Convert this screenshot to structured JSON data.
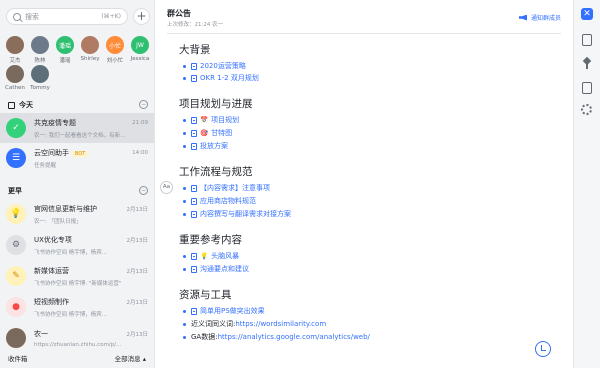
{
  "sidebar": {
    "search_placeholder": "搜索",
    "search_shortcut": "(⌘+K)",
    "add_label": "+",
    "avatars": [
      {
        "name": "艾杰",
        "initial": "",
        "color": "#8a6d5a"
      },
      {
        "name": "陈林",
        "initial": "",
        "color": "#6d7a8a"
      },
      {
        "name": "潘瑶",
        "initial": "潘瑶",
        "color": "#2fbf71"
      },
      {
        "name": "Shirley",
        "initial": "",
        "color": "#b07b62"
      },
      {
        "name": "刘小忙",
        "initial": "小忙",
        "color": "#ff8c3a"
      },
      {
        "name": "Jessica",
        "initial": "JW",
        "color": "#2fbf71"
      },
      {
        "name": "Cathen",
        "initial": "",
        "color": "#7a6a5e"
      },
      {
        "name": "Tommy",
        "initial": "",
        "color": "#5e6f7a"
      }
    ],
    "section_today": "今天",
    "section_earlier": "更早",
    "toggle": "−",
    "chats": [
      {
        "name": "共克疫情专题",
        "time": "21:09",
        "preview": "农一: 我们一起看看这个文档，有新...",
        "color": "#33d17a",
        "glyph": "✓",
        "selected": true
      },
      {
        "name": "云空间助手",
        "badge": "BOT",
        "time": "14:00",
        "preview": "任务提醒",
        "color": "#3370ff",
        "glyph": "☰"
      },
      {
        "name": "官网信息更新与维护",
        "time": "2月13日",
        "preview": "农一: 「团队日报」",
        "color": "#ffc60a",
        "glyph": "💡"
      },
      {
        "name": "UX优化专项",
        "time": "2月13日",
        "preview": "飞书协作空间 杨宇博，杨宾...",
        "color": "#8f959e",
        "glyph": "⚙"
      },
      {
        "name": "新媒体运营",
        "time": "2月13日",
        "preview": "飞书协作空间 杨宇博: \"新媒体运营\"",
        "color": "#ffc60a",
        "glyph": "✎"
      },
      {
        "name": "短视频制作",
        "time": "2月13日",
        "preview": "飞书协作空间 杨宇博，杨宾...",
        "color": "#f54a45",
        "glyph": "●"
      },
      {
        "name": "农一",
        "time": "2月13日",
        "preview": "https://zhuanlan.zhihu.com/p/...",
        "color": "#7a6a5e",
        "glyph": ""
      }
    ],
    "footer_left": "收件箱",
    "footer_right": "全部消息 ▴"
  },
  "doc": {
    "title": "群公告",
    "edited": "上次修改：21:24 农一",
    "notify": "通知群成员",
    "aa": "Aa",
    "sections": [
      {
        "heading": "大背景",
        "items": [
          {
            "text": "2020运营策略",
            "emoji": ""
          },
          {
            "text": "OKR 1-2 双月规划",
            "emoji": ""
          }
        ]
      },
      {
        "heading": "项目规划与进展",
        "items": [
          {
            "text": "项目规划",
            "emoji": "📅"
          },
          {
            "text": "甘特图",
            "emoji": "🎯"
          },
          {
            "text": "投放方案",
            "emoji": ""
          }
        ]
      },
      {
        "heading": "工作流程与规范",
        "items": [
          {
            "text": "【内容需求】注意事项",
            "emoji": ""
          },
          {
            "text": "应用商店物料规范",
            "emoji": ""
          },
          {
            "text": "内容撰写与翻译需求对接方案",
            "emoji": ""
          }
        ]
      },
      {
        "heading": "重要参考内容",
        "items": [
          {
            "text": "头脑风暴",
            "emoji": "💡"
          },
          {
            "text": "沟通要点和建议",
            "emoji": ""
          }
        ]
      },
      {
        "heading": "资源与工具",
        "items": [
          {
            "text": "简单用PS做突出效果",
            "emoji": ""
          }
        ]
      }
    ],
    "plain_items": [
      {
        "label": "近义词同义词: ",
        "link": "https://wordsimilarity.com"
      },
      {
        "label": "GA数据: ",
        "link": "https://analytics.google.com/analytics/web/"
      }
    ]
  },
  "rail": {
    "close": "✕"
  }
}
